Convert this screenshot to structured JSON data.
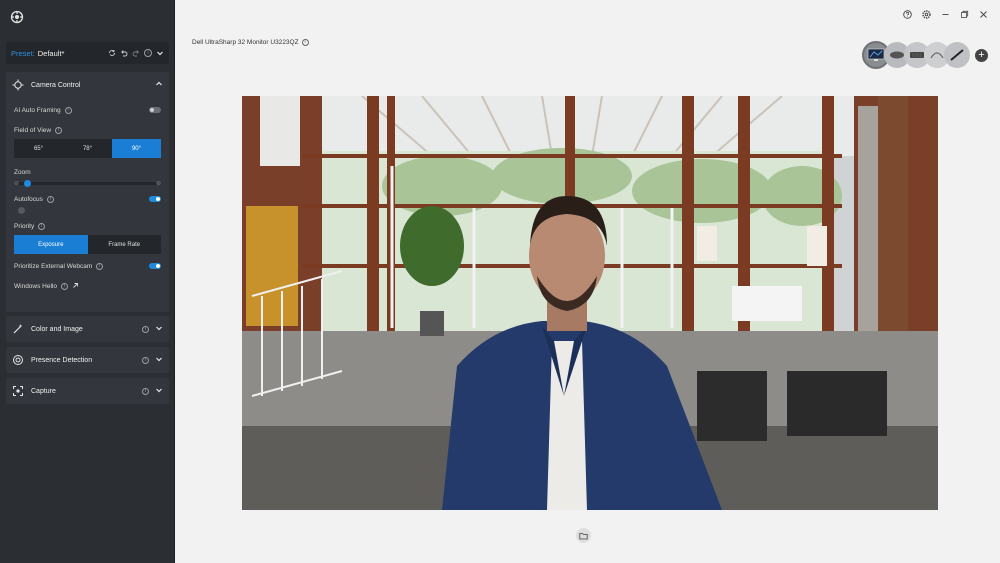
{
  "sidebar": {
    "preset": {
      "label": "Preset:",
      "value": "Default*"
    },
    "camera_control": {
      "title": "Camera Control",
      "ai_auto_framing": {
        "label": "AI Auto Framing",
        "state": "off"
      },
      "field_of_view": {
        "label": "Field of View",
        "options": [
          "65°",
          "78°",
          "90°"
        ],
        "selected": "90°"
      },
      "zoom": {
        "label": "Zoom",
        "value": 0
      },
      "autofocus": {
        "label": "Autofocus",
        "state": "on"
      },
      "priority": {
        "label": "Priority",
        "options": [
          "Exposure",
          "Frame Rate"
        ],
        "selected": "Exposure"
      },
      "prioritize_external": {
        "label": "Prioritize External Webcam",
        "state": "on"
      },
      "windows_hello": {
        "label": "Windows Hello"
      }
    },
    "color_and_image": {
      "title": "Color and Image"
    },
    "presence_detection": {
      "title": "Presence Detection"
    },
    "capture": {
      "title": "Capture"
    }
  },
  "main": {
    "device_title": "Dell UltraSharp 32 Monitor U3223QZ"
  },
  "colors": {
    "accent": "#1a7fd4",
    "sidebar_bg": "#2b2e33",
    "panel_bg": "#33363c"
  }
}
